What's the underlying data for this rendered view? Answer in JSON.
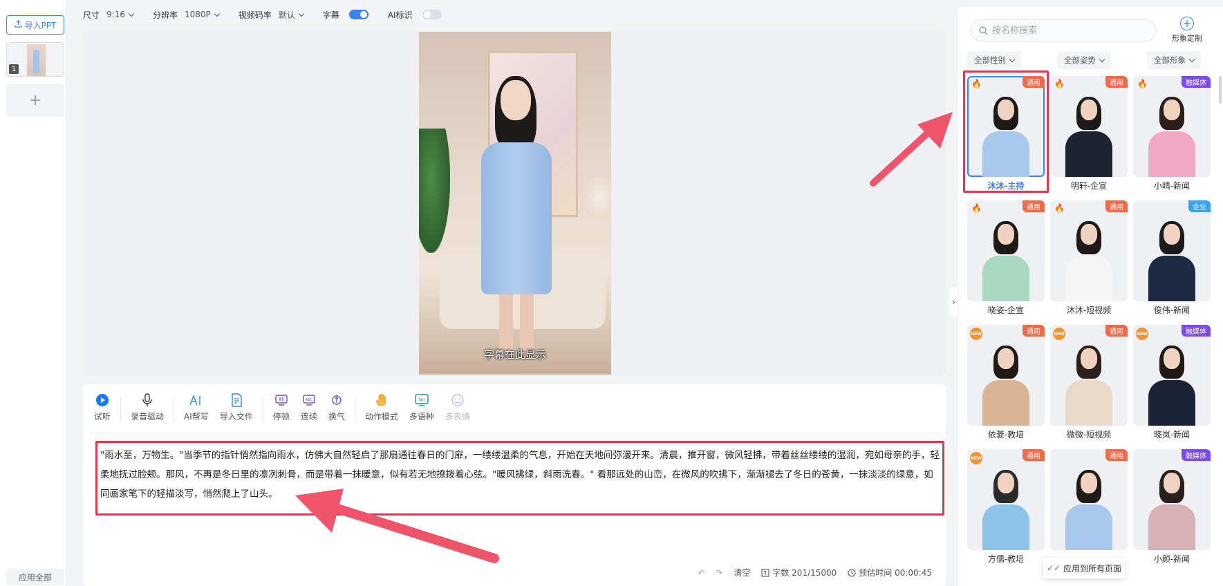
{
  "left": {
    "import_ppt": "导入PPT",
    "slide_number": "1",
    "add_slide": "+",
    "apply_all": "应用全部"
  },
  "topbar": {
    "size_label": "尺寸",
    "size_value": "9:16",
    "resolution_label": "分辨率",
    "resolution_value": "1080P",
    "bitrate_label": "视频码率",
    "bitrate_value": "默认",
    "subtitle_label": "字幕",
    "subtitle_on": true,
    "ai_mark_label": "AI标识",
    "ai_mark_on": false
  },
  "preview": {
    "subtitle_text": "字幕在此显示"
  },
  "toolbar": {
    "items": [
      {
        "label": "试听",
        "icon": "play-icon"
      },
      {
        "label": "录音驱动",
        "icon": "microphone-icon"
      },
      {
        "label": "AI帮写",
        "icon": "ai-write-icon"
      },
      {
        "label": "导入文件",
        "icon": "import-file-icon"
      },
      {
        "label": "停顿",
        "icon": "pause-icon"
      },
      {
        "label": "连续",
        "icon": "continuous-icon"
      },
      {
        "label": "换气",
        "icon": "breath-icon"
      },
      {
        "label": "动作模式",
        "icon": "gesture-icon"
      },
      {
        "label": "多语种",
        "icon": "language-icon"
      },
      {
        "label": "多表情",
        "icon": "emoji-icon"
      }
    ]
  },
  "script": {
    "text": "\"雨水至，万物生。\"当季节的指针悄然指向雨水，仿佛大自然轻启了那扇通往春日的门扉，一缕缕温柔的气息，开始在天地间弥漫开来。清晨，推开窗，微风轻拂，带着丝丝缕缕的湿润，宛如母亲的手，轻柔地抚过脸颊。那风，不再是冬日里的凛冽刺骨，而是带着一抹暖意，似有若无地撩拨着心弦。\"暖风拂绿，斜雨洗春。\" 看那远处的山峦，在微风的吹拂下，渐渐褪去了冬日的苍黄，一抹淡淡的绿意，如同画家笔下的轻描淡写，悄然爬上了山头。"
  },
  "footer": {
    "clear": "清空",
    "word_count": "字数 201/15000",
    "estimated_time": "预估时间 00:00:45"
  },
  "panel": {
    "search_placeholder": "按名称搜索",
    "custom_label": "形象定制",
    "filters": [
      "全部性别",
      "全部姿势",
      "全部形象"
    ],
    "apply_all_pages": "应用到所有页面",
    "avatars": [
      {
        "name": "沐沐-主持",
        "tag": "通用",
        "tag_type": "general",
        "badge": "fire",
        "selected": true,
        "hair": "#1d1916",
        "outfit": "#a9c6ec"
      },
      {
        "name": "明轩-企宣",
        "tag": "通用",
        "tag_type": "general",
        "badge": "fire",
        "selected": false,
        "hair": "#1b1b1b",
        "outfit": "#1f2430"
      },
      {
        "name": "小晴-新闻",
        "tag": "融媒体",
        "tag_type": "media",
        "badge": "fire",
        "selected": false,
        "hair": "#2a1f1a",
        "outfit": "#f0a9c4"
      },
      {
        "name": "晓姿-企宣",
        "tag": "通用",
        "tag_type": "general",
        "badge": "fire",
        "selected": false,
        "hair": "#1f1a17",
        "outfit": "#a9d9c0"
      },
      {
        "name": "沐沐-短视频",
        "tag": "通用",
        "tag_type": "general",
        "badge": "fire",
        "selected": false,
        "hair": "#1f1a17",
        "outfit": "#f5f5f5"
      },
      {
        "name": "俊伟-新闻",
        "tag": "企业",
        "tag_type": "corp",
        "badge": "",
        "selected": false,
        "hair": "#1b1b1b",
        "outfit": "#1d2a44"
      },
      {
        "name": "依菱-教培",
        "tag": "通用",
        "tag_type": "general",
        "badge": "new",
        "selected": false,
        "hair": "#1f1a17",
        "outfit": "#d9b595"
      },
      {
        "name": "微微-短视频",
        "tag": "通用",
        "tag_type": "general",
        "badge": "new",
        "selected": false,
        "hair": "#2a211c",
        "outfit": "#e9d9c8"
      },
      {
        "name": "晓岚-新闻",
        "tag": "融媒体",
        "tag_type": "media",
        "badge": "new",
        "selected": false,
        "hair": "#1f1a17",
        "outfit": "#1c2238"
      },
      {
        "name": "方儒-教培",
        "tag": "通用",
        "tag_type": "general",
        "badge": "new",
        "selected": false,
        "hair": "#2b2b2b",
        "outfit": "#8ec3ea"
      },
      {
        "name": "",
        "tag": "通用",
        "tag_type": "general",
        "badge": "",
        "selected": false,
        "hair": "#1f1a17",
        "outfit": "#a9c6ec"
      },
      {
        "name": "小颜-新闻",
        "tag": "融媒体",
        "tag_type": "media",
        "badge": "",
        "selected": false,
        "hair": "#2a1f1a",
        "outfit": "#d8b0b8"
      }
    ]
  },
  "colors": {
    "accent": "#3b82f6",
    "highlight_red": "#e5354f",
    "tag_general": "#f06a4c",
    "tag_media": "#7b4bf0",
    "tag_corp": "#3aa3ff"
  }
}
